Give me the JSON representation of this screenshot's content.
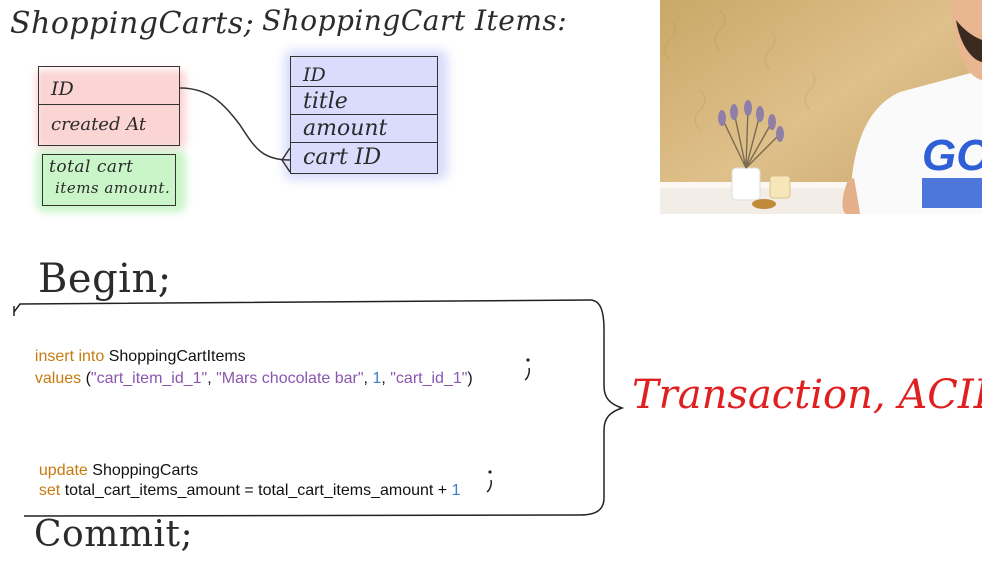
{
  "diagram": {
    "shopping_carts": {
      "title": "ShoppingCarts;",
      "fields": [
        "ID",
        "created At"
      ],
      "computed_field": [
        "total cart",
        "items amount."
      ]
    },
    "shopping_cart_items": {
      "title": "ShoppingCart Items:",
      "fields": [
        "ID",
        "title",
        "amount",
        "cart ID"
      ]
    },
    "colors": {
      "carts_highlight": "#f48f8f",
      "computed_highlight": "#78e678",
      "items_highlight": "#7882f5",
      "ink": "#2b2b2b"
    }
  },
  "video": {
    "shirt_text": "GO"
  },
  "transaction": {
    "begin": "Begin;",
    "insert": {
      "keyword": "insert into",
      "table": "ShoppingCartItems",
      "values_keyword": "values",
      "open": "(",
      "v1": "\"cart_item_id_1\"",
      "sep1": ", ",
      "v2": "\"Mars chocolate bar\"",
      "sep2": ", ",
      "v3": "1",
      "sep3": ", ",
      "v4": "\"cart_id_1\"",
      "close": ")"
    },
    "update": {
      "keyword": "update",
      "table": "ShoppingCarts",
      "set_keyword": "set",
      "lhs": "total_cart_items_amount",
      "eq": " = ",
      "rhs": "total_cart_items_amount",
      "plus": " + ",
      "num": "1"
    },
    "commit": "Commit;",
    "label": "Transaction, ACID",
    "colors": {
      "keyword": "#c77a10",
      "string": "#8a56b0",
      "number": "#3a82c4",
      "label": "#e02020"
    }
  }
}
